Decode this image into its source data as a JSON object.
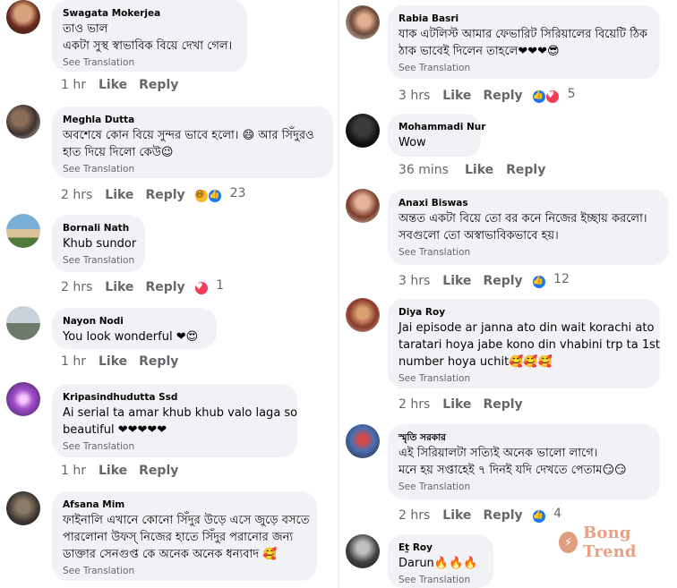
{
  "translation_label": "See Translation",
  "actions": {
    "like": "Like",
    "reply": "Reply"
  },
  "left": [
    {
      "name": "Swagata Mokerjea",
      "lines": [
        "তাও ভাল",
        " একটা সুস্থ স্বাভাবিক বিয়ে দেখা গেল।"
      ],
      "time": "1 hr",
      "reaction": null
    },
    {
      "name": "Meghla Dutta",
      "lines": [
        "অবশেষে কোন বিয়ে সুন্দর ভাবে হলো। 😄 আর সিঁদুরও",
        "হাত দিয়ে দিলো কেউ😉"
      ],
      "time": "2 hrs",
      "reaction": {
        "icons": [
          "haha",
          "like"
        ],
        "count": "23"
      }
    },
    {
      "name": "Bornali Nath",
      "lines": [
        "Khub sundor"
      ],
      "time": "2 hrs",
      "reaction": {
        "icons": [
          "love"
        ],
        "count": "1"
      }
    },
    {
      "name": "Nayon Nodi",
      "lines": [
        "You look wonderful ❤😍"
      ],
      "time": "1 hr",
      "reaction": null
    },
    {
      "name": "Kripasindhudutta Ssd",
      "lines": [
        "Ai serial ta amar khub khub valo laga so",
        "beautiful ❤❤❤❤❤"
      ],
      "time": "1 hr",
      "reaction": null
    },
    {
      "name": "Afsana Mim",
      "lines": [
        "ফাইনালি এখানে কোনো সিঁদুর উড়ে এসে জুড়ে বসতে",
        "পারলোনা উফস্ নিজের হাতে সিঁদুর পরানোর জন্য",
        "ডাক্তার সেনগুপ্ত কে অনেক অনেক ধন্যবাদ 🥰"
      ],
      "time": "",
      "reaction": null
    }
  ],
  "right": [
    {
      "name": "Rabia Basri",
      "lines": [
        "যাক এটলিস্ট আমার ফেভারিট সিরিয়ালের বিয়েটি ঠিক",
        "ঠাক ভাবেই দিলেন তাহলে❤❤❤😎"
      ],
      "time": "3 hrs",
      "reaction": {
        "icons": [
          "like",
          "love"
        ],
        "count": "5"
      }
    },
    {
      "name": "Mohammadi Nur",
      "lines": [
        "Wow"
      ],
      "time": "36 mins",
      "reaction": null
    },
    {
      "name": "Anaxi Biswas",
      "lines": [
        "অন্তত একটা বিয়ে তো বর কনে নিজের ইচ্ছায় করলো।",
        "সবগুলো তো অস্বাভাবিকভাবে হয়।"
      ],
      "time": "3 hrs",
      "reaction": {
        "icons": [
          "like"
        ],
        "count": "12"
      }
    },
    {
      "name": "Diya Roy",
      "lines": [
        "Jai episode ar janna ato din wait korachi ato",
        "taratari hoya jabe kono din vhabini trp ta 1st",
        "number hoya uchit🥰🥰🥰"
      ],
      "time": "2 hrs",
      "reaction": null
    },
    {
      "name": "স্মৃতি সরকার",
      "lines": [
        "এই সিরিয়ালটা সত্যিই অনেক ভালো লাগে।",
        "মনে হয় সপ্তাহেই ৭ দিনই যদি দেখতে পেতাম😏😏"
      ],
      "time": "2 hrs",
      "reaction": {
        "icons": [
          "like"
        ],
        "count": "4"
      }
    },
    {
      "name": "Et̰ Roy",
      "lines": [
        "Darun🔥🔥🔥"
      ],
      "time": "",
      "reaction": null
    }
  ],
  "watermark": {
    "text": "Bong Trend",
    "icon": "bong-trend-logo-icon"
  },
  "colors": {
    "bubble": "#f0f2f5",
    "meta": "#65676b",
    "like": "#1877f2",
    "love": "#f33e58",
    "haha": "#f7b928",
    "watermark": "#e8a283"
  }
}
